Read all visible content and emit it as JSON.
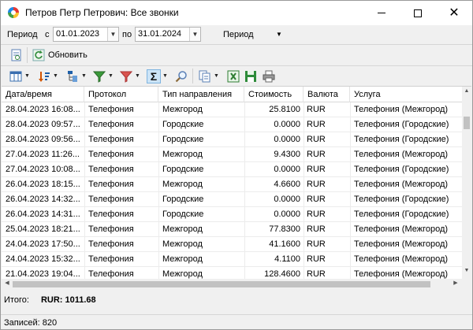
{
  "window": {
    "title": "Петров Петр Петрович: Все звонки"
  },
  "period": {
    "label": "Период",
    "from_label": "с",
    "from_value": "01.01.2023",
    "to_label": "по",
    "to_value": "31.01.2024",
    "select_value": "Период"
  },
  "toolbar": {
    "refresh_label": "Обновить"
  },
  "tools": [
    {
      "icon": "grid-columns-icon"
    },
    {
      "icon": "sort-icon"
    },
    {
      "icon": "group-tree-icon"
    },
    {
      "icon": "filter-icon"
    },
    {
      "icon": "filter-clear-icon"
    },
    {
      "icon": "sum-icon"
    },
    {
      "icon": "search-icon"
    },
    {
      "icon": "copy-icon"
    },
    {
      "icon": "export-excel-icon"
    },
    {
      "icon": "save-icon"
    },
    {
      "icon": "print-icon"
    }
  ],
  "grid": {
    "columns": [
      "Дата/время",
      "Протокол",
      "Тип направления",
      "Стоимость",
      "Валюта",
      "Услуга"
    ],
    "rows": [
      [
        "28.04.2023 16:08...",
        "Телефония",
        "Межгород",
        "25.8100",
        "RUR",
        "Телефония (Межгород)"
      ],
      [
        "28.04.2023 09:57...",
        "Телефония",
        "Городские",
        "0.0000",
        "RUR",
        "Телефония (Городские)"
      ],
      [
        "28.04.2023 09:56...",
        "Телефония",
        "Городские",
        "0.0000",
        "RUR",
        "Телефония (Городские)"
      ],
      [
        "27.04.2023 11:26...",
        "Телефония",
        "Межгород",
        "9.4300",
        "RUR",
        "Телефония (Межгород)"
      ],
      [
        "27.04.2023 10:08...",
        "Телефония",
        "Городские",
        "0.0000",
        "RUR",
        "Телефония (Городские)"
      ],
      [
        "26.04.2023 18:15...",
        "Телефония",
        "Межгород",
        "4.6600",
        "RUR",
        "Телефония (Межгород)"
      ],
      [
        "26.04.2023 14:32...",
        "Телефония",
        "Городские",
        "0.0000",
        "RUR",
        "Телефония (Городские)"
      ],
      [
        "26.04.2023 14:31...",
        "Телефония",
        "Городские",
        "0.0000",
        "RUR",
        "Телефония (Городские)"
      ],
      [
        "25.04.2023 18:21...",
        "Телефония",
        "Межгород",
        "77.8300",
        "RUR",
        "Телефония (Межгород)"
      ],
      [
        "24.04.2023 17:50...",
        "Телефония",
        "Межгород",
        "41.1600",
        "RUR",
        "Телефония (Межгород)"
      ],
      [
        "24.04.2023 15:32...",
        "Телефония",
        "Межгород",
        "4.1100",
        "RUR",
        "Телефония (Межгород)"
      ],
      [
        "21.04.2023 19:04...",
        "Телефония",
        "Межгород",
        "128.4600",
        "RUR",
        "Телефония (Межгород)"
      ]
    ]
  },
  "totals": {
    "label": "Итого:",
    "value": "RUR: 1011.68"
  },
  "status": {
    "records": "Записей: 820"
  }
}
